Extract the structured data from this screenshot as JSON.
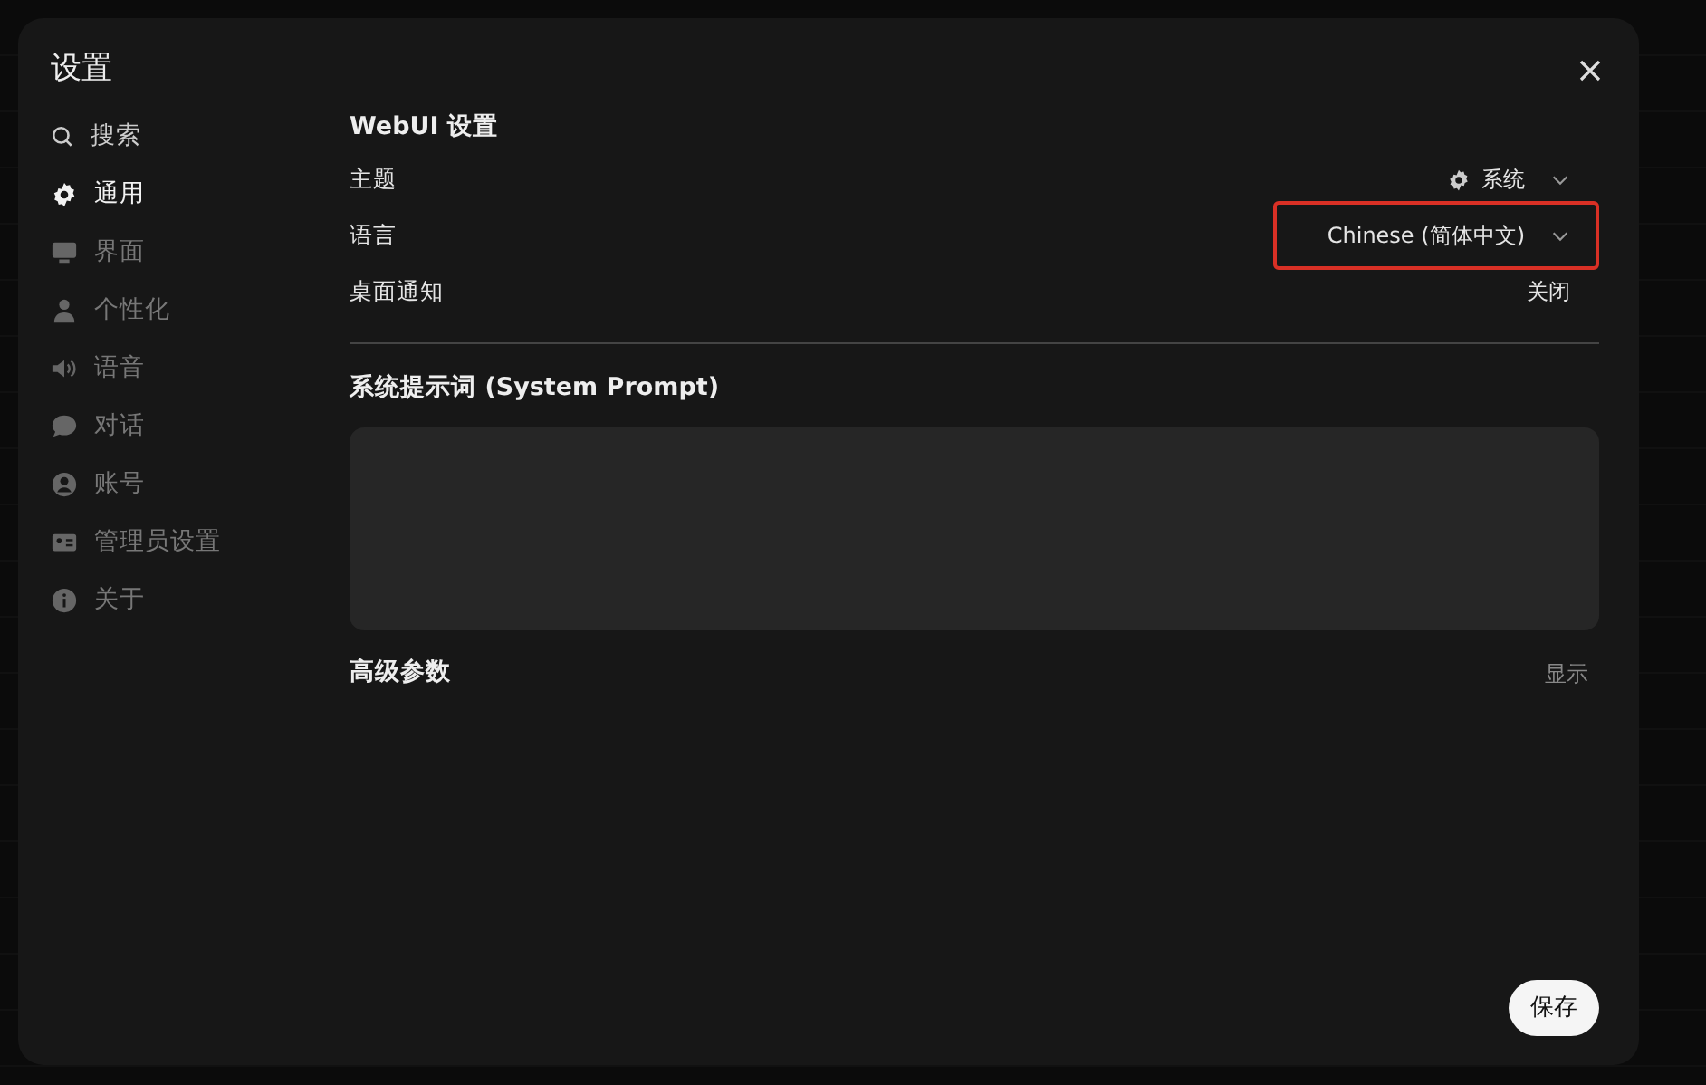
{
  "dialog": {
    "title": "设置"
  },
  "sidebar": {
    "search": {
      "placeholder": "搜索"
    },
    "items": [
      {
        "label": "通用",
        "kind": "gear",
        "selected": true
      },
      {
        "label": "界面",
        "kind": "monitor",
        "selected": false
      },
      {
        "label": "个性化",
        "kind": "person",
        "selected": false
      },
      {
        "label": "语音",
        "kind": "speaker",
        "selected": false
      },
      {
        "label": "对话",
        "kind": "chat",
        "selected": false
      },
      {
        "label": "账号",
        "kind": "account",
        "selected": false
      },
      {
        "label": "管理员设置",
        "kind": "idcard",
        "selected": false
      },
      {
        "label": "关于",
        "kind": "info",
        "selected": false
      }
    ]
  },
  "webui": {
    "heading": "WebUI 设置",
    "rows": [
      {
        "label": "主题",
        "value": "系统",
        "kind": "icon_select",
        "highlighted": false
      },
      {
        "label": "语言",
        "value": "Chinese (简体中文)",
        "kind": "select",
        "highlighted": true
      },
      {
        "label": "桌面通知",
        "value": "关闭",
        "kind": "toggle",
        "highlighted": false
      }
    ]
  },
  "system_prompt": {
    "heading": "系统提示词 (System Prompt)"
  },
  "advanced": {
    "heading": "高级参数",
    "toggle": "显示"
  },
  "buttons": [
    "保存"
  ]
}
